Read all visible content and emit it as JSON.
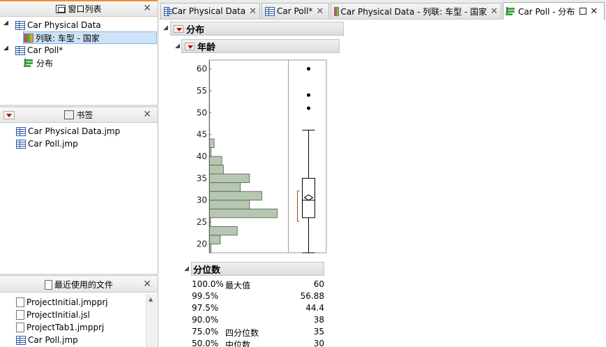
{
  "window_list": {
    "title": "窗口列表",
    "items": [
      {
        "label": "Car Physical Data",
        "children": [
          {
            "label": "列联: 车型 - 国家"
          }
        ]
      },
      {
        "label": "Car Poll*",
        "children": [
          {
            "label": "分布"
          }
        ]
      }
    ]
  },
  "bookmarks": {
    "title": "书签",
    "items": [
      "Car Physical Data.jmp",
      "Car Poll.jmp"
    ]
  },
  "recent_files": {
    "title": "最近使用的文件",
    "items": [
      "ProjectInitial.jmpprj",
      "ProjectInitial.jsl",
      "ProjectTab1.jmpprj",
      "Car Poll.jmp"
    ]
  },
  "tabs": [
    {
      "label": "Car Physical Data",
      "icon": "table-icon"
    },
    {
      "label": "Car Poll*",
      "icon": "table-icon"
    },
    {
      "label": "Car Physical Data - 列联: 车型 - 国家",
      "icon": "tile-icon"
    },
    {
      "label": "Car Poll - 分布",
      "icon": "distribution-icon",
      "active": true
    }
  ],
  "report": {
    "title": "分布",
    "variable": "年龄",
    "quantiles_title": "分位数",
    "quantiles": [
      {
        "pct": "100.0%",
        "label": "最大值",
        "value": "60"
      },
      {
        "pct": "99.5%",
        "label": "",
        "value": "56.88"
      },
      {
        "pct": "97.5%",
        "label": "",
        "value": "44.4"
      },
      {
        "pct": "90.0%",
        "label": "",
        "value": "38"
      },
      {
        "pct": "75.0%",
        "label": "四分位数",
        "value": "35"
      },
      {
        "pct": "50.0%",
        "label": "中位数",
        "value": "30"
      }
    ]
  },
  "chart_data": {
    "type": "bar",
    "orientation": "horizontal",
    "y_ticks": [
      20,
      25,
      30,
      35,
      40,
      45,
      50,
      55,
      60
    ],
    "ylim": [
      18,
      62
    ],
    "bins": [
      {
        "from": 18,
        "to": 20,
        "count": 0.5
      },
      {
        "from": 20,
        "to": 22,
        "count": 3.5
      },
      {
        "from": 22,
        "to": 24,
        "count": 9
      },
      {
        "from": 24,
        "to": 26,
        "count": 0.3
      },
      {
        "from": 26,
        "to": 28,
        "count": 22
      },
      {
        "from": 28,
        "to": 30,
        "count": 13
      },
      {
        "from": 30,
        "to": 32,
        "count": 17
      },
      {
        "from": 32,
        "to": 34,
        "count": 10
      },
      {
        "from": 34,
        "to": 36,
        "count": 13
      },
      {
        "from": 36,
        "to": 38,
        "count": 4.5
      },
      {
        "from": 38,
        "to": 40,
        "count": 4
      },
      {
        "from": 40,
        "to": 42,
        "count": 0.5
      },
      {
        "from": 42,
        "to": 44,
        "count": 1.5
      }
    ],
    "box": {
      "min": 18,
      "q1": 26,
      "median": 30,
      "mean": 30.6,
      "q3": 35,
      "whisker_high": 46,
      "ci_low": 25.2,
      "ci_high": 32.1
    },
    "outliers": [
      51,
      54,
      60
    ],
    "bar_color": "#b7c8b2"
  }
}
